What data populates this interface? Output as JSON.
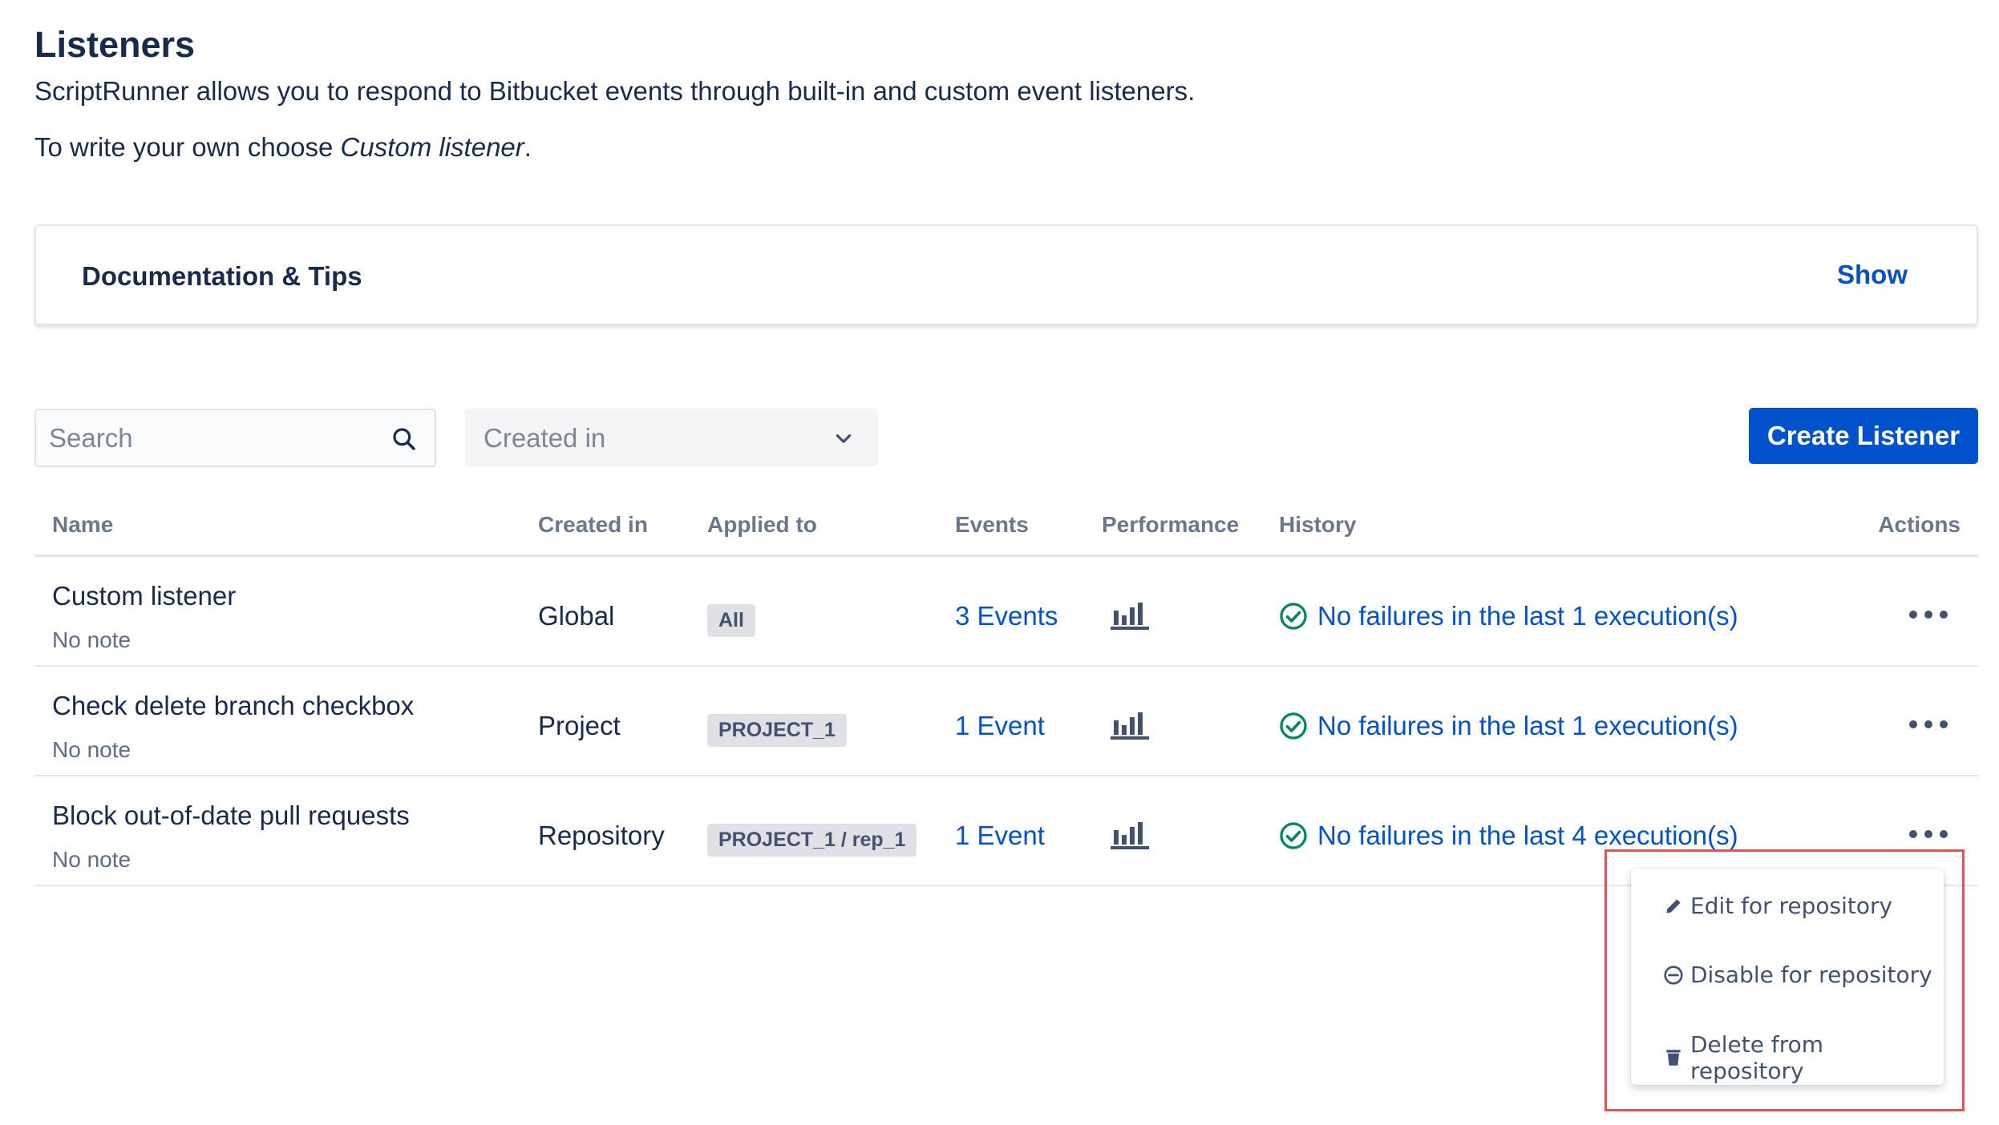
{
  "page": {
    "title": "Listeners",
    "intro": "ScriptRunner allows you to respond to Bitbucket events through built-in and custom event listeners.",
    "intro2_prefix": "To write your own choose ",
    "intro2_em": "Custom listener",
    "intro2_suffix": "."
  },
  "doc_panel": {
    "title": "Documentation & Tips",
    "toggle_label": "Show"
  },
  "search": {
    "placeholder": "Search",
    "value": ""
  },
  "filter": {
    "label": "Created in"
  },
  "create_button": {
    "label": "Create Listener"
  },
  "table": {
    "headers": {
      "name": "Name",
      "created": "Created in",
      "applied": "Applied to",
      "events": "Events",
      "performance": "Performance",
      "history": "History",
      "actions": "Actions"
    },
    "rows": [
      {
        "name": "Custom listener",
        "note": "No note",
        "created": "Global",
        "applied": "All",
        "events": "3 Events",
        "history": "No failures in the last 1 execution(s)"
      },
      {
        "name": "Check delete branch checkbox",
        "note": "No note",
        "created": "Project",
        "applied": "PROJECT_1",
        "events": "1 Event",
        "history": "No failures in the last 1 execution(s)"
      },
      {
        "name": "Block out-of-date pull requests",
        "note": "No note",
        "created": "Repository",
        "applied": "PROJECT_1 / rep_1",
        "events": "1 Event",
        "history": "No failures in the last 4 execution(s)"
      }
    ]
  },
  "action_menu": {
    "items": [
      {
        "label": "Edit for repository",
        "icon": "pencil-icon"
      },
      {
        "label": "Disable for repository",
        "icon": "minus-circle-icon"
      },
      {
        "label": "Delete from repository",
        "icon": "trash-icon"
      }
    ]
  },
  "colors": {
    "link": "#0052cc",
    "primary_button": "#0052cc",
    "success": "#00875a",
    "highlight": "#e8524f"
  }
}
